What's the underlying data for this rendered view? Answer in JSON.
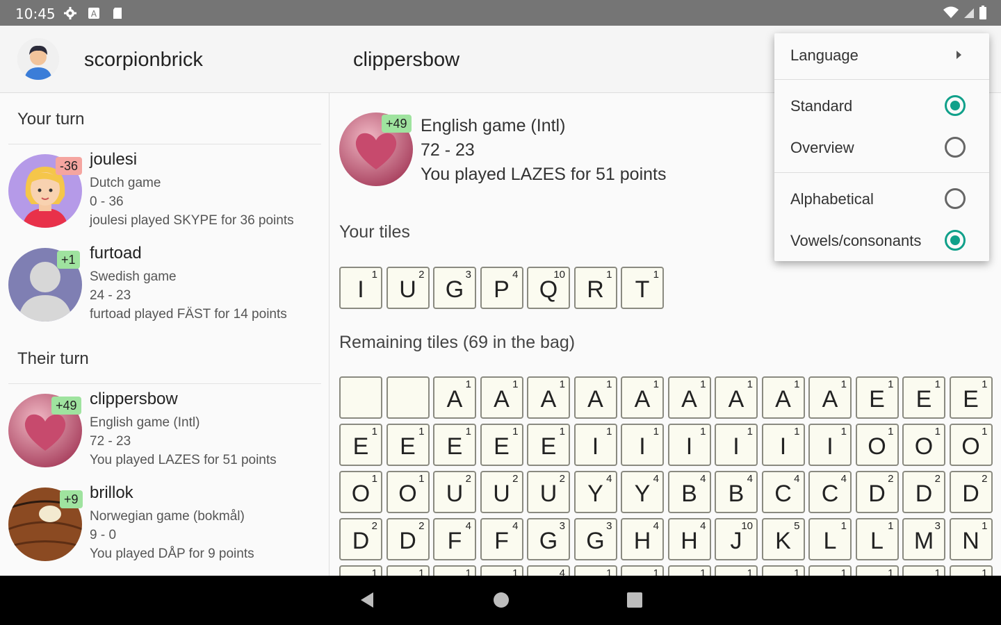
{
  "status_bar": {
    "time": "10:45",
    "icons": [
      "gear-icon",
      "a-icon",
      "sd-card-icon",
      "wifi-icon",
      "signal-icon",
      "battery-icon"
    ]
  },
  "header": {
    "username": "scorpionbrick",
    "opponent": "clippersbow"
  },
  "left_panel": {
    "your_turn_title": "Your turn",
    "their_turn_title": "Their turn",
    "your_turn_games": [
      {
        "name": "joulesi",
        "badge": "-36",
        "language": "Dutch game",
        "score": "0 - 36",
        "last_move": "joulesi played SKYPE for 36 points"
      },
      {
        "name": "furtoad",
        "badge": "+1",
        "language": "Swedish game",
        "score": "24 - 23",
        "last_move": "furtoad played FÄST for 14 points"
      }
    ],
    "their_turn_games": [
      {
        "name": "clippersbow",
        "badge": "+49",
        "language": "English game (Intl)",
        "score": "72 - 23",
        "last_move": "You played LAZES for 51 points"
      },
      {
        "name": "brillok",
        "badge": "+9",
        "language": "Norwegian game (bokmål)",
        "score": "9 - 0",
        "last_move": "You played DÅP for 9 points"
      }
    ]
  },
  "main": {
    "badge": "+49",
    "game_title": "English game (Intl)",
    "score": "72 - 23",
    "last_move": "You played LAZES for 51 points",
    "your_tiles_label": "Your tiles",
    "remaining_label": "Remaining tiles (69 in the bag)",
    "your_tiles": [
      {
        "l": "I",
        "p": "1"
      },
      {
        "l": "U",
        "p": "2"
      },
      {
        "l": "G",
        "p": "3"
      },
      {
        "l": "P",
        "p": "4"
      },
      {
        "l": "Q",
        "p": "10"
      },
      {
        "l": "R",
        "p": "1"
      },
      {
        "l": "T",
        "p": "1"
      }
    ],
    "remaining_rows": [
      [
        {
          "l": "",
          "p": ""
        },
        {
          "l": "",
          "p": ""
        },
        {
          "l": "A",
          "p": "1"
        },
        {
          "l": "A",
          "p": "1"
        },
        {
          "l": "A",
          "p": "1"
        },
        {
          "l": "A",
          "p": "1"
        },
        {
          "l": "A",
          "p": "1"
        },
        {
          "l": "A",
          "p": "1"
        },
        {
          "l": "A",
          "p": "1"
        },
        {
          "l": "A",
          "p": "1"
        },
        {
          "l": "A",
          "p": "1"
        },
        {
          "l": "E",
          "p": "1"
        },
        {
          "l": "E",
          "p": "1"
        },
        {
          "l": "E",
          "p": "1"
        }
      ],
      [
        {
          "l": "E",
          "p": "1"
        },
        {
          "l": "E",
          "p": "1"
        },
        {
          "l": "E",
          "p": "1"
        },
        {
          "l": "E",
          "p": "1"
        },
        {
          "l": "E",
          "p": "1"
        },
        {
          "l": "I",
          "p": "1"
        },
        {
          "l": "I",
          "p": "1"
        },
        {
          "l": "I",
          "p": "1"
        },
        {
          "l": "I",
          "p": "1"
        },
        {
          "l": "I",
          "p": "1"
        },
        {
          "l": "I",
          "p": "1"
        },
        {
          "l": "O",
          "p": "1"
        },
        {
          "l": "O",
          "p": "1"
        },
        {
          "l": "O",
          "p": "1"
        }
      ],
      [
        {
          "l": "O",
          "p": "1"
        },
        {
          "l": "O",
          "p": "1"
        },
        {
          "l": "U",
          "p": "2"
        },
        {
          "l": "U",
          "p": "2"
        },
        {
          "l": "U",
          "p": "2"
        },
        {
          "l": "Y",
          "p": "4"
        },
        {
          "l": "Y",
          "p": "4"
        },
        {
          "l": "B",
          "p": "4"
        },
        {
          "l": "B",
          "p": "4"
        },
        {
          "l": "C",
          "p": "4"
        },
        {
          "l": "C",
          "p": "4"
        },
        {
          "l": "D",
          "p": "2"
        },
        {
          "l": "D",
          "p": "2"
        },
        {
          "l": "D",
          "p": "2"
        }
      ],
      [
        {
          "l": "D",
          "p": "2"
        },
        {
          "l": "D",
          "p": "2"
        },
        {
          "l": "F",
          "p": "4"
        },
        {
          "l": "F",
          "p": "4"
        },
        {
          "l": "G",
          "p": "3"
        },
        {
          "l": "G",
          "p": "3"
        },
        {
          "l": "H",
          "p": "4"
        },
        {
          "l": "H",
          "p": "4"
        },
        {
          "l": "J",
          "p": "10"
        },
        {
          "l": "K",
          "p": "5"
        },
        {
          "l": "L",
          "p": "1"
        },
        {
          "l": "L",
          "p": "1"
        },
        {
          "l": "M",
          "p": "3"
        },
        {
          "l": "N",
          "p": "1"
        }
      ],
      [
        {
          "l": "",
          "p": "1"
        },
        {
          "l": "",
          "p": "1"
        },
        {
          "l": "",
          "p": "1"
        },
        {
          "l": "",
          "p": "1"
        },
        {
          "l": "",
          "p": "4"
        },
        {
          "l": "",
          "p": "1"
        },
        {
          "l": "",
          "p": "1"
        },
        {
          "l": "",
          "p": "1"
        },
        {
          "l": "",
          "p": "1"
        },
        {
          "l": "",
          "p": "1"
        },
        {
          "l": "",
          "p": "1"
        },
        {
          "l": "",
          "p": "1"
        },
        {
          "l": "",
          "p": "1"
        },
        {
          "l": "",
          "p": "1"
        }
      ]
    ]
  },
  "menu": {
    "language": "Language",
    "standard": "Standard",
    "overview": "Overview",
    "alphabetical": "Alphabetical",
    "vowels": "Vowels/consonants",
    "accent_color": "#10a08a"
  },
  "colors": {
    "badge_negative": "#f5a5a0",
    "badge_positive": "#9fe39f",
    "tile_face": "#fbfbf0",
    "status_bar": "#757575"
  }
}
